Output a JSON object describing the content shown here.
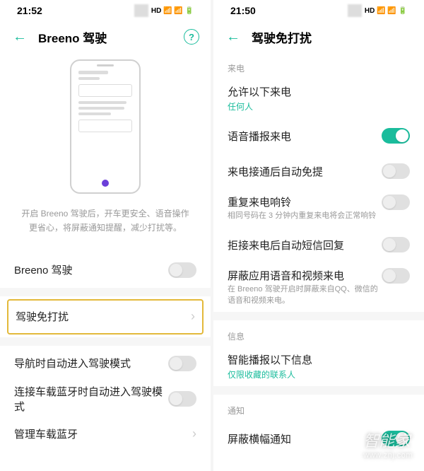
{
  "left": {
    "status_time": "21:52",
    "status_right": "HD 📶 📶 🔋",
    "title": "Breeno 驾驶",
    "desc": "开启 Breeno 驾驶后，开车更安全、语音操作更省心，将屏蔽通知提醒，减少打扰等。",
    "rows": {
      "breeno_drive": "Breeno 驾驶",
      "dnd": "驾驶免打扰",
      "auto_on_nav": "导航时自动进入驾驶模式",
      "auto_on_bt": "连接车载蓝牙时自动进入驾驶模式",
      "manage_bt": "管理车载蓝牙"
    }
  },
  "right": {
    "status_time": "21:50",
    "status_right": "HD 📶 📶 🔋",
    "title": "驾驶免打扰",
    "sections": {
      "incoming_call": "来电",
      "messages": "信息",
      "notifications": "通知"
    },
    "rows": {
      "allow_calls": {
        "label": "允许以下来电",
        "value": "任何人"
      },
      "voice_announce": "语音播报来电",
      "auto_handsfree": "来电接通后自动免提",
      "repeat_ring": {
        "label": "重复来电响铃",
        "sub": "相同号码在 3 分钟内重复来电将会正常响铃"
      },
      "auto_reply": "拒接来电后自动短信回复",
      "block_appcall": {
        "label": "屏蔽应用语音和视频来电",
        "sub": "在 Breeno 驾驶开启时屏蔽来自QQ、微信的语音和视频来电。"
      },
      "smart_broadcast": {
        "label": "智能播报以下信息",
        "value": "仅限收藏的联系人"
      },
      "block_banner": "屏蔽横幅通知"
    },
    "toggles": {
      "voice_announce": true,
      "auto_handsfree": false,
      "repeat_ring": false,
      "auto_reply": false,
      "block_appcall": false,
      "block_banner": true
    }
  },
  "watermark": {
    "main": "智能家",
    "sub": "www.znj.com"
  }
}
